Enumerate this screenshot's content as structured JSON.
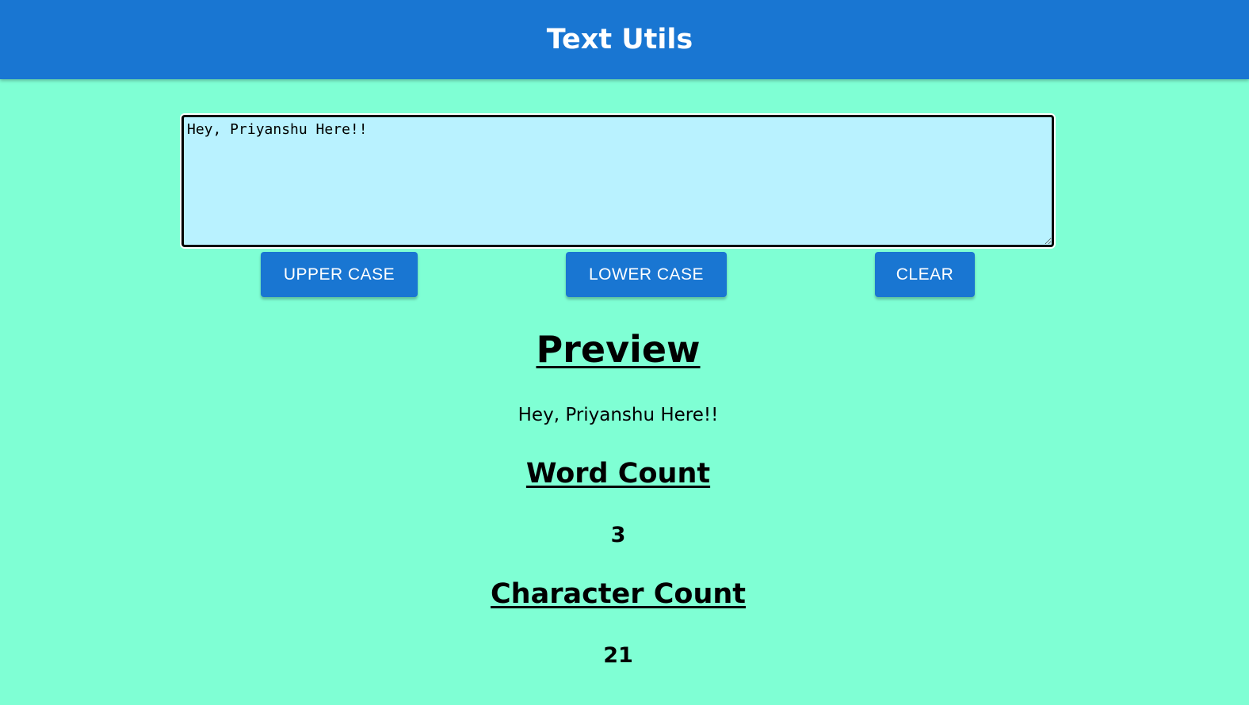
{
  "header": {
    "title": "Text Utils"
  },
  "editor": {
    "value": "Hey, Priyanshu Here!!"
  },
  "buttons": {
    "upper": "UPPER CASE",
    "lower": "LOWER CASE",
    "clear": "CLEAR"
  },
  "preview": {
    "heading": "Preview",
    "text": "Hey, Priyanshu Here!!"
  },
  "word_count": {
    "heading": "Word Count",
    "value": "3"
  },
  "char_count": {
    "heading": "Character Count",
    "value": "21"
  },
  "colors": {
    "header_bg": "#1976d2",
    "page_bg": "#7fffd4",
    "textarea_bg": "#b9f2ff",
    "button_bg": "#1976d2"
  }
}
